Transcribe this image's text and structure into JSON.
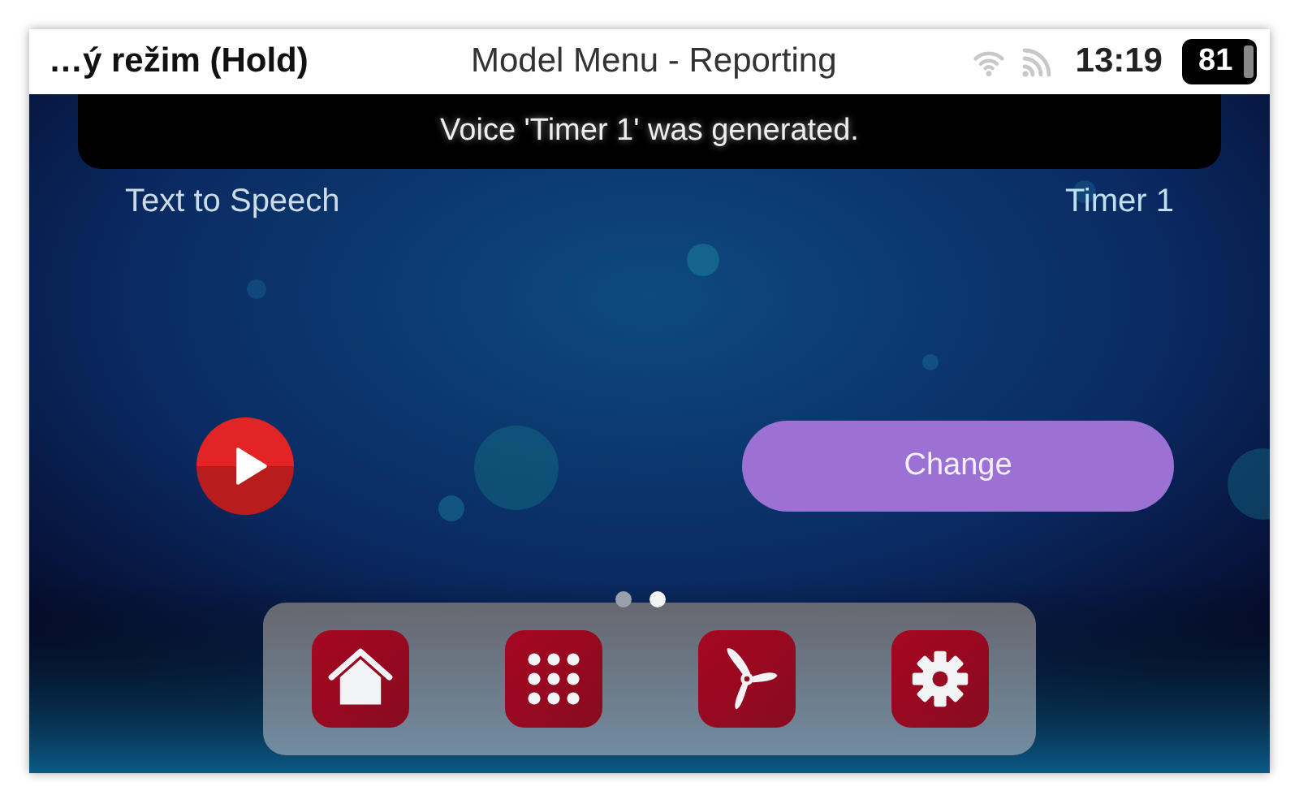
{
  "status_bar": {
    "mode": "…ý režim (Hold)",
    "title": "Model Menu - Reporting",
    "time": "13:19",
    "battery": "81"
  },
  "toast": {
    "message": "Voice 'Timer 1' was generated."
  },
  "setting": {
    "label": "Text to Speech",
    "value": "Timer 1"
  },
  "actions": {
    "change_button": "Change"
  },
  "pages": [
    {
      "selected": false
    },
    {
      "selected": true
    }
  ],
  "dock": [
    {
      "kind": "home"
    },
    {
      "kind": "apps"
    },
    {
      "kind": "model"
    },
    {
      "kind": "settings"
    }
  ]
}
